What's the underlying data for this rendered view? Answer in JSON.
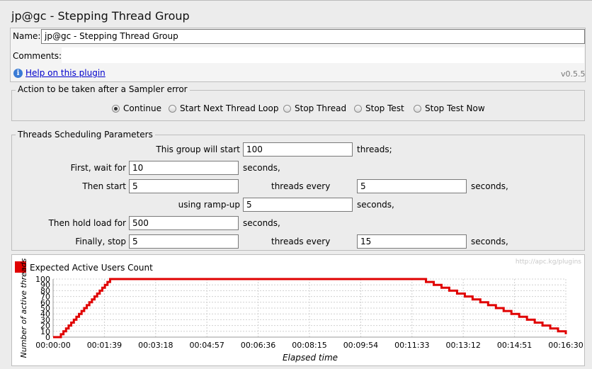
{
  "window": {
    "title": "jp@gc - Stepping Thread Group"
  },
  "meta": {
    "name_label": "Name:",
    "name_value": "jp@gc - Stepping Thread Group",
    "comments_label": "Comments:",
    "comments_value": "",
    "help_link": "Help on this plugin",
    "version": "v0.5.5"
  },
  "sampler_error": {
    "legend": "Action to be taken after a Sampler error",
    "options": [
      {
        "label": "Continue",
        "selected": true
      },
      {
        "label": "Start Next Thread Loop",
        "selected": false
      },
      {
        "label": "Stop Thread",
        "selected": false
      },
      {
        "label": "Stop Test",
        "selected": false
      },
      {
        "label": "Stop Test Now",
        "selected": false
      }
    ]
  },
  "scheduling": {
    "legend": "Threads Scheduling Parameters",
    "row1": {
      "label": "This group will start",
      "value": "100",
      "unit": "threads;"
    },
    "row2": {
      "label": "First, wait for",
      "value": "10",
      "unit": "seconds,"
    },
    "row3": {
      "label": "Then start",
      "value": "5",
      "mid": "threads every",
      "value2": "5",
      "unit": "seconds,"
    },
    "row4": {
      "label": "using ramp-up",
      "value": "5",
      "unit": "seconds,"
    },
    "row5": {
      "label": "Then hold load for",
      "value": "500",
      "unit": "seconds,"
    },
    "row6": {
      "label": "Finally, stop",
      "value": "5",
      "mid": "threads every",
      "value2": "15",
      "unit": "seconds,"
    }
  },
  "chart": {
    "watermark": "http://apc.kg/plugins",
    "legend_color": "#e00000",
    "grid": true
  },
  "chart_data": {
    "type": "line",
    "title": "",
    "xlabel": "Elapsed time",
    "ylabel": "Number of active threads",
    "series": [
      {
        "name": "Expected Active Users Count",
        "color": "#e00000",
        "description_points_seconds_to_threads": true,
        "x": [
          0,
          10,
          15,
          20,
          25,
          30,
          35,
          40,
          45,
          50,
          55,
          60,
          65,
          70,
          75,
          80,
          85,
          90,
          95,
          100,
          105,
          110,
          115,
          120,
          125,
          130,
          135,
          140,
          145,
          150,
          155,
          160,
          165,
          170,
          175,
          180,
          185,
          190,
          195,
          200,
          205,
          705,
          720,
          735,
          750,
          765,
          780,
          795,
          810,
          825,
          840,
          855,
          870,
          885,
          900,
          915,
          930,
          945,
          960,
          975,
          990
        ],
        "y": [
          0,
          0,
          5,
          10,
          15,
          20,
          25,
          30,
          35,
          40,
          45,
          50,
          55,
          60,
          65,
          70,
          75,
          80,
          85,
          90,
          95,
          100,
          100,
          100,
          100,
          100,
          100,
          100,
          100,
          100,
          100,
          100,
          100,
          100,
          100,
          100,
          100,
          100,
          100,
          100,
          100,
          100,
          95,
          90,
          85,
          80,
          75,
          70,
          65,
          60,
          55,
          50,
          45,
          40,
          35,
          30,
          25,
          20,
          15,
          10,
          5
        ]
      }
    ],
    "x_ticks": [
      "00:00:00",
      "00:01:39",
      "00:03:18",
      "00:04:57",
      "00:06:36",
      "00:08:15",
      "00:09:54",
      "00:11:33",
      "00:13:12",
      "00:14:51",
      "00:16:30"
    ],
    "y_ticks": [
      "0",
      "10",
      "20",
      "30",
      "40",
      "50",
      "60",
      "70",
      "80",
      "90",
      "100"
    ],
    "xlim": [
      0,
      990
    ],
    "ylim": [
      0,
      100
    ],
    "legend": "top-left"
  }
}
